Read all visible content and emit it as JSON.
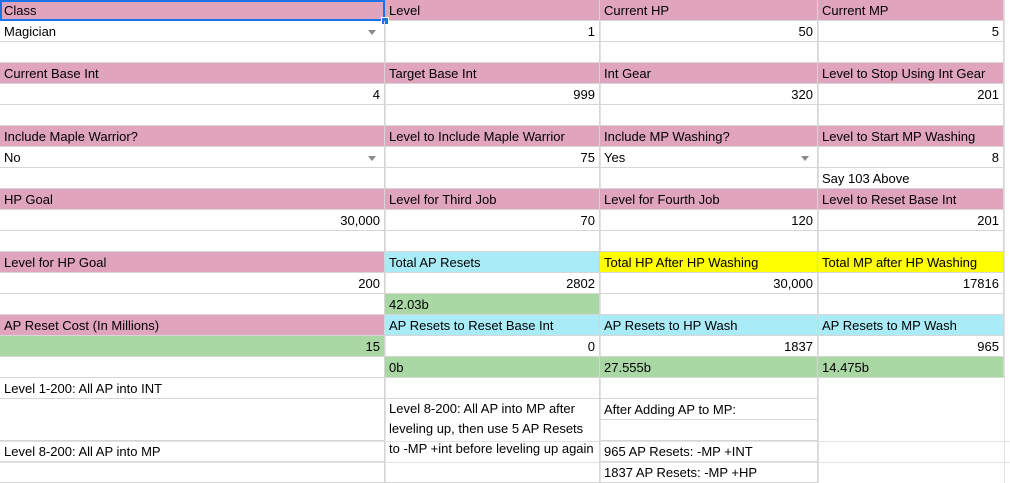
{
  "r1": {
    "class_h": "Class",
    "level_h": "Level",
    "hp_h": "Current HP",
    "mp_h": "Current MP"
  },
  "r2": {
    "class_v": "Magician",
    "level_v": "1",
    "hp_v": "50",
    "mp_v": "5"
  },
  "r3": {
    "base_int_h": "Current Base Int",
    "target_int_h": "Target Base Int",
    "int_gear_h": "Int Gear",
    "stop_gear_h": "Level to Stop Using Int Gear"
  },
  "r4": {
    "base_int_v": "4",
    "target_int_v": "999",
    "int_gear_v": "320",
    "stop_gear_v": "201"
  },
  "r5": {
    "mw_h": "Include Maple Warrior?",
    "mw_level_h": "Level to Include Maple Warrior",
    "mpw_h": "Include MP Washing?",
    "mpw_level_h": "Level to Start MP Washing"
  },
  "r6": {
    "mw_v": "No",
    "mw_level_v": "75",
    "mpw_v": "Yes",
    "mpw_level_v": "8"
  },
  "r7": {
    "note": "Say 103 Above"
  },
  "r8": {
    "hp_goal_h": "HP Goal",
    "third_h": "Level for Third Job",
    "fourth_h": "Level for Fourth Job",
    "reset_h": "Level to Reset Base Int"
  },
  "r9": {
    "hp_goal_v": "30,000",
    "third_v": "70",
    "fourth_v": "120",
    "reset_v": "201"
  },
  "r10": {
    "lvl_hp_h": "Level for HP Goal",
    "total_ap_h": "Total AP Resets",
    "total_hp_h": "Total HP After HP Washing",
    "total_mp_h": "Total MP after HP Washing"
  },
  "r11": {
    "lvl_hp_v": "200",
    "total_ap_v": "2802",
    "total_hp_v": "30,000",
    "total_mp_v": "17816"
  },
  "r12": {
    "cost_total": "42.03b"
  },
  "r13": {
    "cost_h": "AP Reset Cost (In Millions)",
    "reset_int_h": "AP Resets to Reset Base Int",
    "hp_wash_h": "AP Resets to HP Wash",
    "mp_wash_h": "AP Resets to MP Wash"
  },
  "r14": {
    "cost_v": "15",
    "reset_int_v": "0",
    "hp_wash_v": "1837",
    "mp_wash_v": "965"
  },
  "r15": {
    "reset_int_cost": "0b",
    "hp_wash_cost": "27.555b",
    "mp_wash_cost": "14.475b"
  },
  "notes": {
    "a1": "Level 1-200: All AP into INT",
    "a2": "Level 8-200: All AP into MP",
    "b": "Level 8-200: All AP into MP after leveling up, then use 5 AP Resets to -MP +int before leveling up again",
    "c1": "After Adding AP to MP:",
    "c2": "965 AP Resets: -MP +INT",
    "c3": "1837 AP Resets: -MP +HP"
  }
}
